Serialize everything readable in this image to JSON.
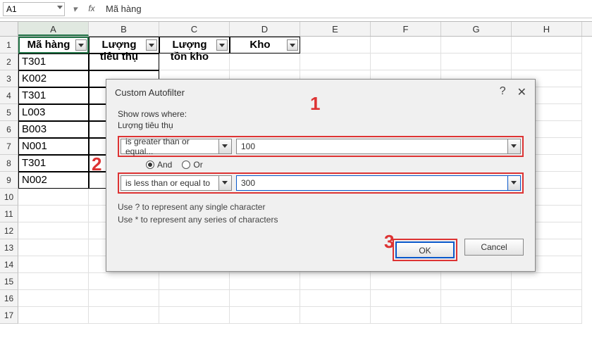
{
  "namebox": "A1",
  "formula": "Mã hàng",
  "columns": [
    "A",
    "B",
    "C",
    "D",
    "E",
    "F",
    "G",
    "H"
  ],
  "row_numbers": [
    1,
    2,
    3,
    4,
    5,
    6,
    7,
    8,
    9,
    10,
    11,
    12,
    13,
    14,
    15,
    16,
    17
  ],
  "headers": [
    "Mã hàng",
    "Lượng tiêu thụ",
    "Lượng tồn kho",
    "Kho"
  ],
  "colA": [
    "T301",
    "K002",
    "T301",
    "L003",
    "B003",
    "N001",
    "T301",
    "N002"
  ],
  "dialog": {
    "title": "Custom Autofilter",
    "help": "?",
    "close": "✕",
    "show_rows": "Show rows where:",
    "field": "Lượng tiêu thụ",
    "op1": "is greater than or equal...",
    "val1": "100",
    "and": "And",
    "or": "Or",
    "op2": "is less than or equal to",
    "val2": "300",
    "hint1": "Use ? to represent any single character",
    "hint2": "Use * to represent any series of characters",
    "ok": "OK",
    "cancel": "Cancel"
  },
  "annot": {
    "n1": "1",
    "n2": "2",
    "n3": "3"
  }
}
